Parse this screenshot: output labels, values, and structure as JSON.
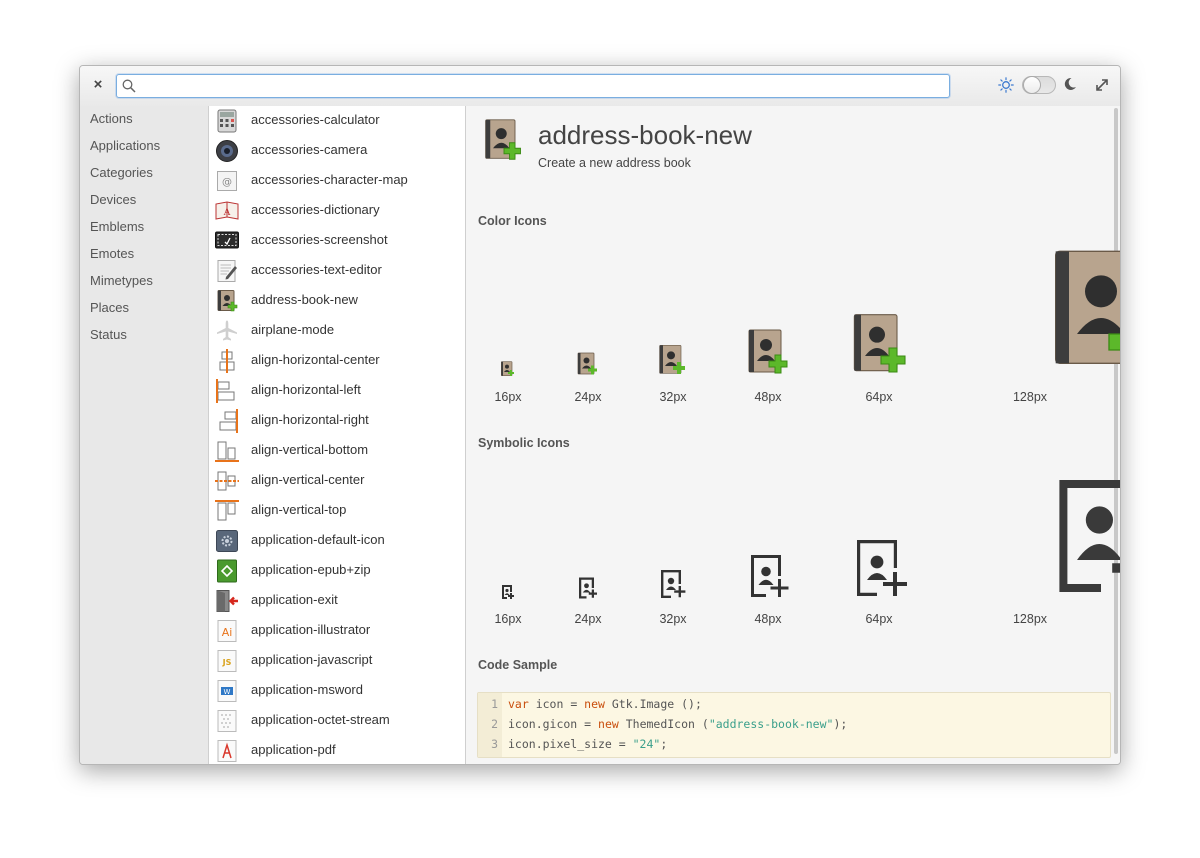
{
  "header": {
    "close_label": "×",
    "search": {
      "value": "",
      "placeholder": ""
    }
  },
  "categories": [
    "Actions",
    "Applications",
    "Categories",
    "Devices",
    "Emblems",
    "Emotes",
    "Mimetypes",
    "Places",
    "Status"
  ],
  "icons": [
    "accessories-calculator",
    "accessories-camera",
    "accessories-character-map",
    "accessories-dictionary",
    "accessories-screenshot",
    "accessories-text-editor",
    "address-book-new",
    "airplane-mode",
    "align-horizontal-center",
    "align-horizontal-left",
    "align-horizontal-right",
    "align-vertical-bottom",
    "align-vertical-center",
    "align-vertical-top",
    "application-default-icon",
    "application-epub+zip",
    "application-exit",
    "application-illustrator",
    "application-javascript",
    "application-msword",
    "application-octet-stream",
    "application-pdf"
  ],
  "detail": {
    "title": "address-book-new",
    "subtitle": "Create a new address book",
    "color_section": "Color Icons",
    "symbolic_section": "Symbolic Icons",
    "code_section": "Code Sample",
    "sizes": [
      "16px",
      "24px",
      "32px",
      "48px",
      "64px",
      "128px"
    ],
    "code": {
      "line_numbers": [
        "1",
        "2",
        "3"
      ],
      "line1": {
        "kw1": "var",
        "rest1": " icon = ",
        "kw2": "new",
        "rest2": " Gtk.Image ();"
      },
      "line2": {
        "rest1": "icon.gicon = ",
        "kw": "new",
        "rest2": " ThemedIcon (",
        "str": "\"address-book-new\"",
        "rest3": ");"
      },
      "line3": {
        "rest1": "icon.pixel_size = ",
        "str": "\"24\"",
        "rest2": ";"
      }
    }
  },
  "colors": {
    "accent": "#7aaee0",
    "keyword": "#c94f0e",
    "string": "#3a9f8b",
    "plus_green": "#5cb82a"
  }
}
